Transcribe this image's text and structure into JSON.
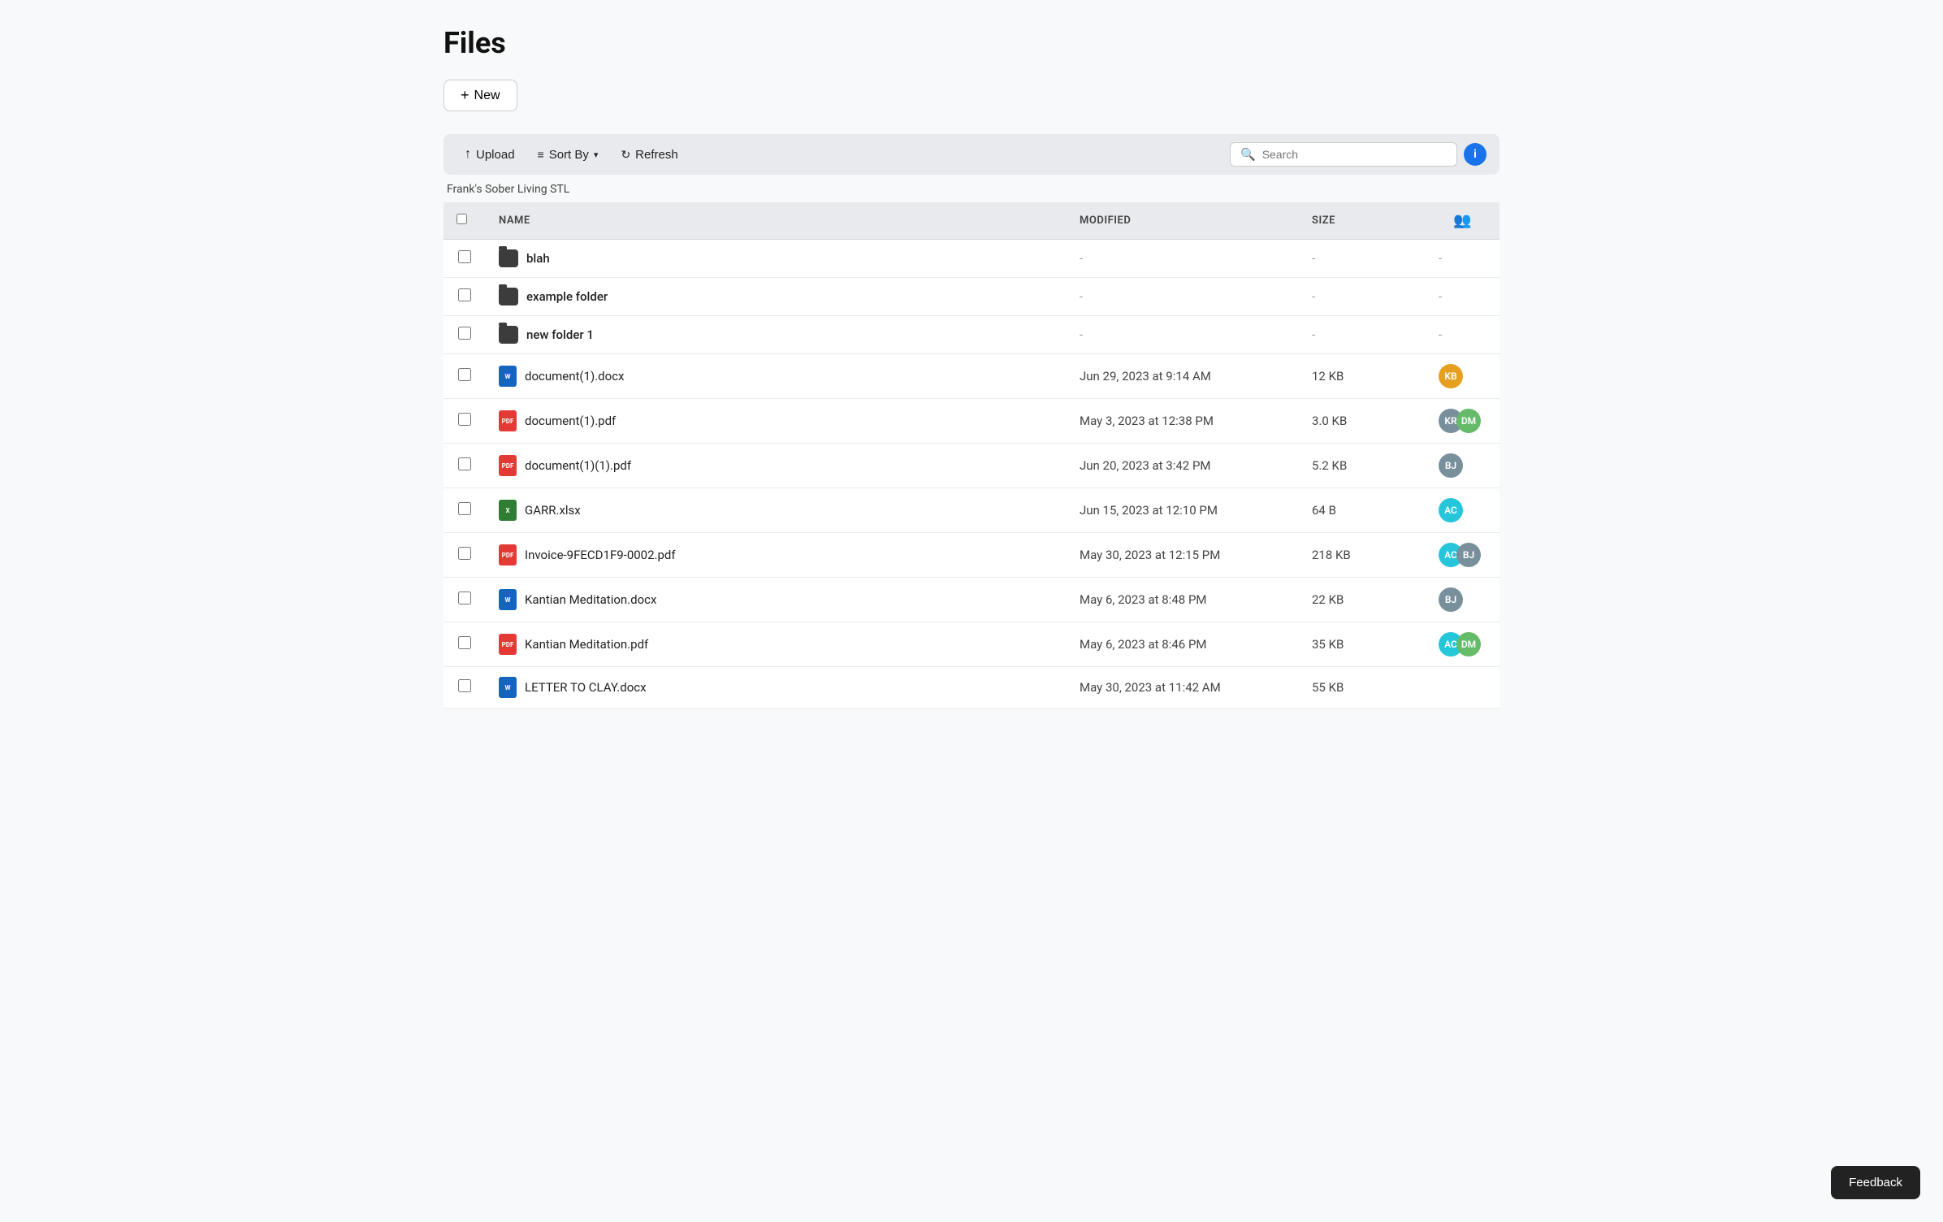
{
  "page": {
    "title": "Files"
  },
  "toolbar": {
    "new_label": "New",
    "upload_label": "Upload",
    "sort_label": "Sort By",
    "refresh_label": "Refresh",
    "search_placeholder": "Search",
    "info_label": "i"
  },
  "breadcrumb": {
    "text": "Frank's Sober Living STL"
  },
  "table": {
    "headers": {
      "check": "",
      "name": "NAME",
      "modified": "MODIFIED",
      "size": "SIZE",
      "shared": ""
    },
    "rows": [
      {
        "type": "folder",
        "name": "blah",
        "modified": "-",
        "size": "-",
        "shared": "-",
        "avatars": []
      },
      {
        "type": "folder",
        "name": "example folder",
        "modified": "-",
        "size": "-",
        "shared": "-",
        "avatars": []
      },
      {
        "type": "folder",
        "name": "new folder 1",
        "modified": "-",
        "size": "-",
        "shared": "-",
        "avatars": []
      },
      {
        "type": "docx",
        "name": "document(1).docx",
        "modified": "Jun 29, 2023 at 9:14 AM",
        "size": "12 KB",
        "shared": "",
        "avatars": [
          {
            "initials": "KB",
            "color": "#e6a020"
          }
        ]
      },
      {
        "type": "pdf",
        "name": "document(1).pdf",
        "modified": "May 3, 2023 at 12:38 PM",
        "size": "3.0 KB",
        "shared": "",
        "avatars": [
          {
            "initials": "KR",
            "color": "#78909c"
          },
          {
            "initials": "DM",
            "color": "#66bb6a"
          }
        ]
      },
      {
        "type": "pdf",
        "name": "document(1)(1).pdf",
        "modified": "Jun 20, 2023 at 3:42 PM",
        "size": "5.2 KB",
        "shared": "",
        "avatars": [
          {
            "initials": "BJ",
            "color": "#78909c"
          }
        ]
      },
      {
        "type": "xlsx",
        "name": "GARR.xlsx",
        "modified": "Jun 15, 2023 at 12:10 PM",
        "size": "64 B",
        "shared": "",
        "avatars": [
          {
            "initials": "AC",
            "color": "#26c6da"
          }
        ]
      },
      {
        "type": "pdf",
        "name": "Invoice-9FECD1F9-0002.pdf",
        "modified": "May 30, 2023 at 12:15 PM",
        "size": "218 KB",
        "shared": "",
        "avatars": [
          {
            "initials": "AC",
            "color": "#26c6da"
          },
          {
            "initials": "BJ",
            "color": "#78909c"
          }
        ]
      },
      {
        "type": "docx",
        "name": "Kantian Meditation.docx",
        "modified": "May 6, 2023 at 8:48 PM",
        "size": "22 KB",
        "shared": "",
        "avatars": [
          {
            "initials": "BJ",
            "color": "#78909c"
          }
        ]
      },
      {
        "type": "pdf",
        "name": "Kantian Meditation.pdf",
        "modified": "May 6, 2023 at 8:46 PM",
        "size": "35 KB",
        "shared": "",
        "avatars": [
          {
            "initials": "AC",
            "color": "#26c6da"
          },
          {
            "initials": "DM",
            "color": "#66bb6a"
          }
        ]
      },
      {
        "type": "docx",
        "name": "LETTER TO CLAY.docx",
        "modified": "May 30, 2023 at 11:42 AM",
        "size": "55 KB",
        "shared": "",
        "avatars": []
      }
    ]
  },
  "feedback": {
    "label": "Feedback"
  }
}
